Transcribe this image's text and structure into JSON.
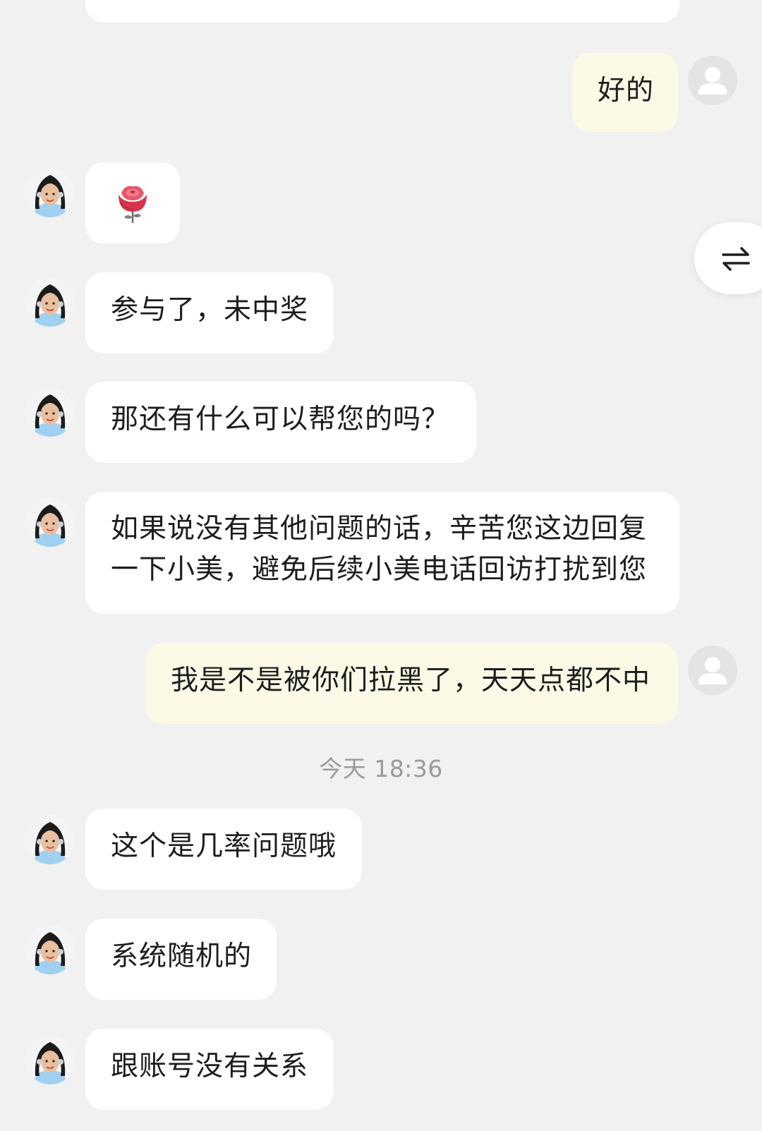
{
  "conversation": {
    "timestamp": "今天 18:36",
    "messages": [
      {
        "sender": "user",
        "text": "好的"
      },
      {
        "sender": "agent",
        "emoji": "rose-emoji"
      },
      {
        "sender": "agent",
        "text": "参与了，未中奖"
      },
      {
        "sender": "agent",
        "text": "那还有什么可以帮您的吗？"
      },
      {
        "sender": "agent",
        "lines": [
          "如果说没有其他问题的话，辛苦您这边回复",
          "一下小美，避免后续小美电话回访打扰到您"
        ]
      },
      {
        "sender": "user",
        "text": "我是不是被你们拉黑了，天天点都不中"
      },
      {
        "sender": "agent",
        "text": "这个是几率问题哦"
      },
      {
        "sender": "agent",
        "text": "系统随机的"
      },
      {
        "sender": "agent",
        "text": "跟账号没有关系"
      }
    ]
  },
  "floating_button": {
    "icon": "swap-arrows-icon"
  },
  "colors": {
    "background": "#f1f1f1",
    "agent_bubble": "#ffffff",
    "user_bubble": "#fcfae6",
    "timestamp_text": "#9a9a9a"
  }
}
